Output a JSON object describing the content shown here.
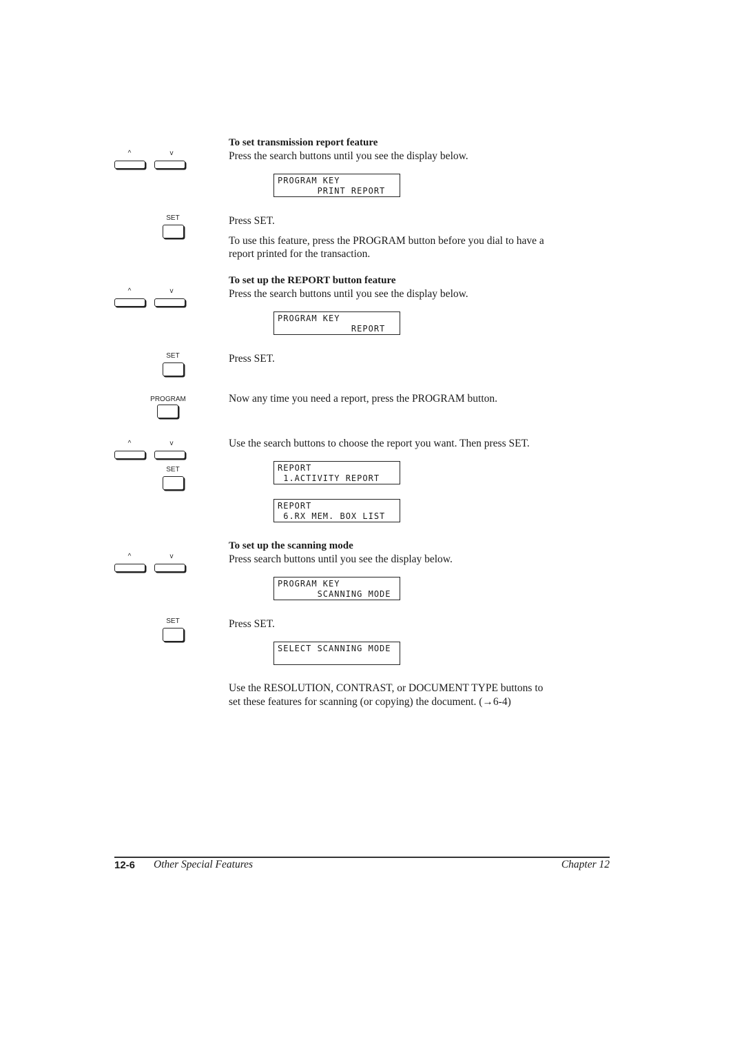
{
  "sections": [
    {
      "heading": "To set transmission report feature",
      "intro": "Press the search buttons until you see the display below.",
      "display1": [
        "PROGRAM KEY",
        "       PRINT REPORT"
      ],
      "press_set": "Press SET.",
      "note_line1": "To use this feature, press the PROGRAM button before you dial to have a",
      "note_line2": "report printed for the transaction."
    },
    {
      "heading": "To set up the REPORT button feature",
      "intro": "Press the search buttons until you see the display below.",
      "display1": [
        "PROGRAM KEY",
        "             REPORT"
      ],
      "press_set": "Press SET.",
      "program_note": "Now any time you need a report, press the PROGRAM button.",
      "choose_note": "Use the search buttons to choose the report you want. Then press SET.",
      "display2": [
        "REPORT",
        " 1.ACTIVITY REPORT"
      ],
      "display3": [
        "REPORT",
        " 6.RX MEM. BOX LIST"
      ]
    },
    {
      "heading": "To set up the scanning mode",
      "intro": "Press search buttons until you see the display below.",
      "display1": [
        "PROGRAM KEY",
        "       SCANNING MODE"
      ],
      "press_set": "Press SET.",
      "display2": [
        "SELECT SCANNING MODE",
        ""
      ],
      "final_line1": "Use the RESOLUTION, CONTRAST, or DOCUMENT TYPE buttons to",
      "final_line2": "set these features for scanning (or copying) the document. (→6-4)"
    }
  ],
  "keys": {
    "up": "^",
    "down": "v",
    "set": "SET",
    "program": "PROGRAM"
  },
  "footer": {
    "page": "12-6",
    "title": "Other Special Features",
    "chapter": "Chapter 12"
  }
}
